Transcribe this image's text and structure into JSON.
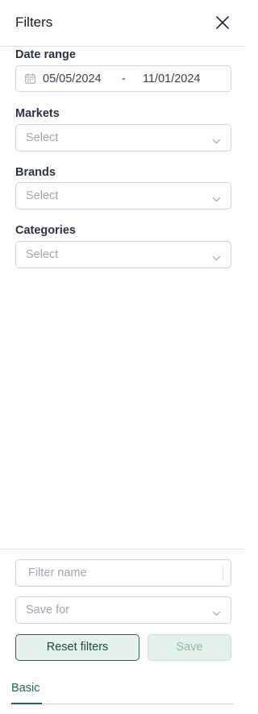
{
  "header": {
    "title": "Filters",
    "close_icon": "close-icon"
  },
  "date_range": {
    "label": "Date range",
    "start": "05/05/2024",
    "separator": "-",
    "end": "11/01/2024",
    "icon": "calendar-icon"
  },
  "markets": {
    "label": "Markets",
    "placeholder": "Select"
  },
  "brands": {
    "label": "Brands",
    "placeholder": "Select"
  },
  "categories": {
    "label": "Categories",
    "placeholder": "Select"
  },
  "footer": {
    "filter_name_placeholder": "Filter name",
    "save_for_placeholder": "Save for",
    "reset_label": "Reset filters",
    "save_label": "Save"
  },
  "tabs": [
    {
      "label": "Basic",
      "active": true
    }
  ],
  "colors": {
    "accent": "#1b6b49",
    "border": "#d1d5db",
    "placeholder": "#a1a7b0"
  }
}
